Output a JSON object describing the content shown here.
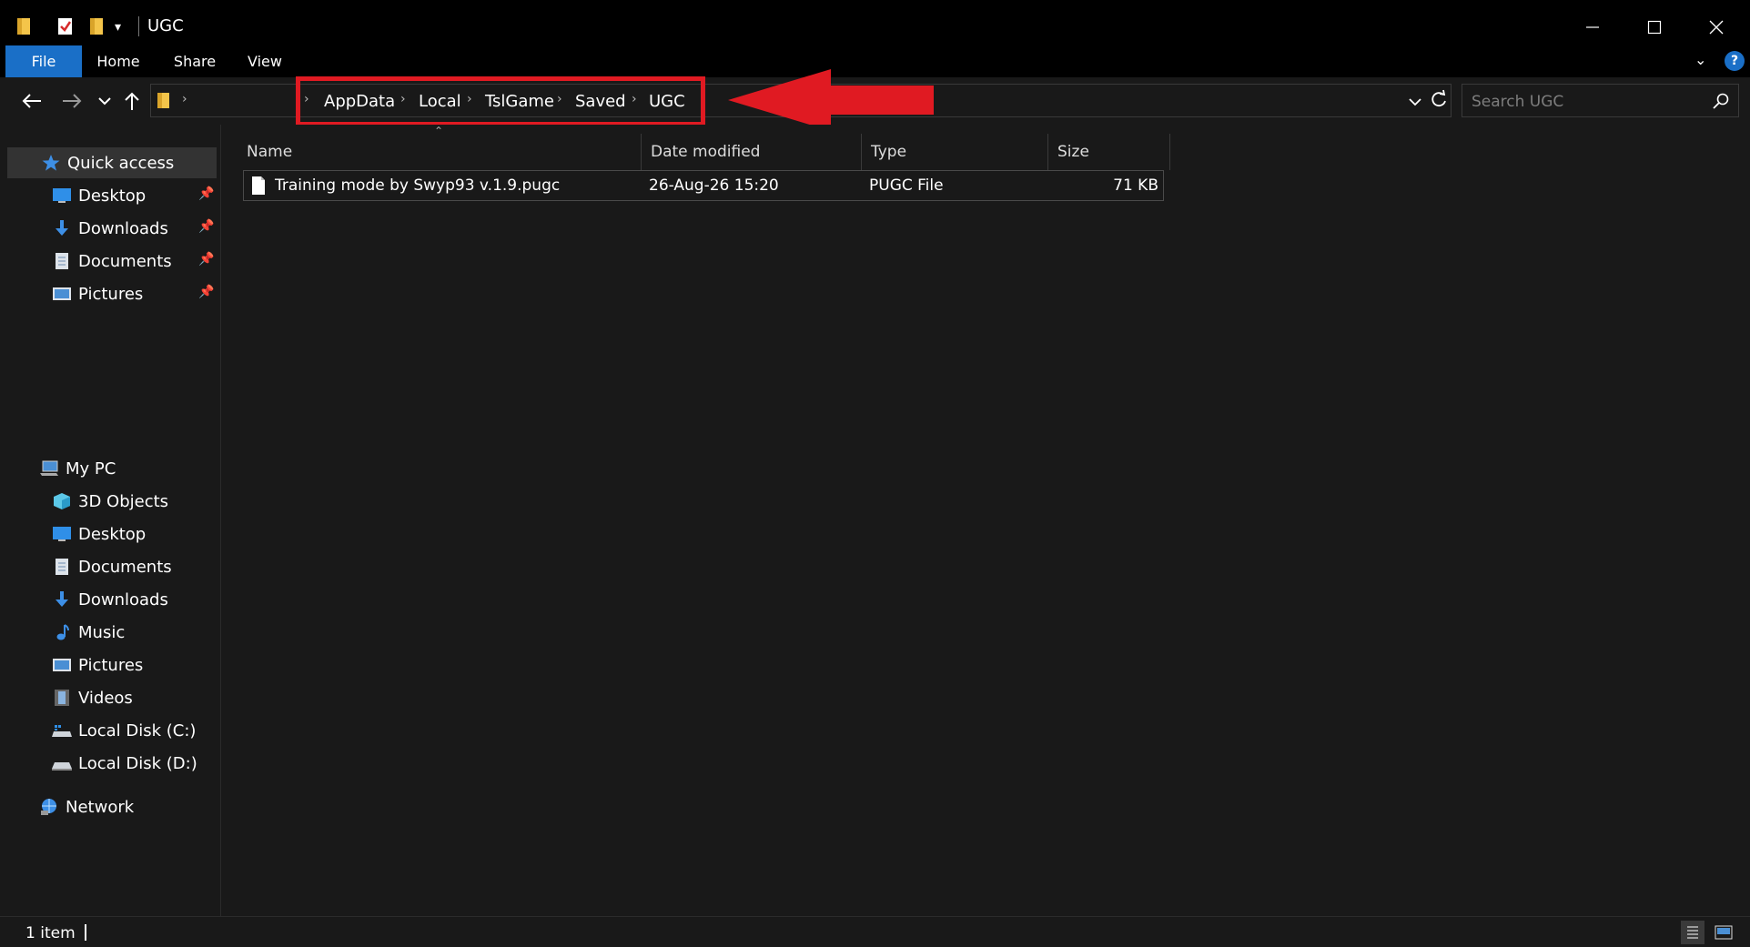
{
  "window": {
    "title": "UGC"
  },
  "ribbon": {
    "tabs": [
      "File",
      "Home",
      "Share",
      "View"
    ]
  },
  "breadcrumb": [
    "AppData",
    "Local",
    "TslGame",
    "Saved",
    "UGC"
  ],
  "search": {
    "placeholder": "Search UGC"
  },
  "sidebar": {
    "quick_access": "Quick access",
    "pinned": [
      "Desktop",
      "Downloads",
      "Documents",
      "Pictures"
    ],
    "this_pc": "My PC",
    "pc_items": [
      "3D Objects",
      "Desktop",
      "Documents",
      "Downloads",
      "Music",
      "Pictures",
      "Videos",
      "Local Disk (C:)",
      "Local Disk (D:)"
    ],
    "network": "Network"
  },
  "columns": [
    "Name",
    "Date modified",
    "Type",
    "Size"
  ],
  "files": [
    {
      "name": "Training mode by Swyp93 v.1.9.pugc",
      "date": "26-Aug-26 15:20",
      "type": "PUGC File",
      "size": "71 KB"
    }
  ],
  "status": {
    "count": "1 item"
  },
  "colors": {
    "accent": "#1a6fc7",
    "annotation": "#e01a22",
    "background": "#191919"
  }
}
